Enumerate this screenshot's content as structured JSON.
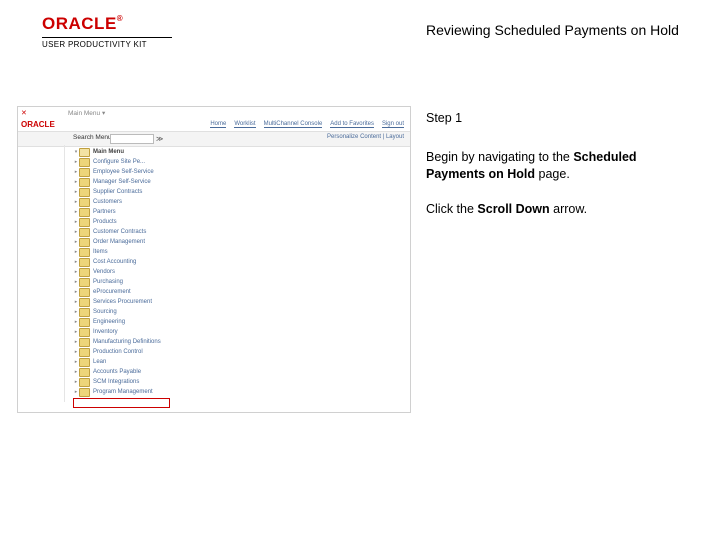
{
  "logo": {
    "brand": "ORACLE",
    "reg": "®",
    "sub": "USER PRODUCTIVITY KIT"
  },
  "title": "Reviewing Scheduled Payments on Hold",
  "instructions": {
    "step": "Step 1",
    "para1_a": "Begin by navigating to the ",
    "para1_b": "Scheduled Payments on Hold",
    "para1_c": " page.",
    "para2_a": "Click the ",
    "para2_b": "Scroll Down",
    "para2_c": " arrow."
  },
  "app": {
    "top_tabs": "Main Menu ▾",
    "tiny_brand": "ORACLE",
    "nav": [
      "Home",
      "Worklist",
      "MultiChannel Console",
      "Add to Favorites",
      "Sign out"
    ],
    "search_label": "Search Menu:",
    "go": "≫",
    "pcenter": "Personalize Content | Layout",
    "menu_top": "Main Menu",
    "menu_items": [
      "Configure Site Pe...",
      "Employee Self-Service",
      "Manager Self-Service",
      "Supplier Contracts",
      "Customers",
      "Partners",
      "Products",
      "Customer Contracts",
      "Order Management",
      "Items",
      "Cost Accounting",
      "Vendors",
      "Purchasing",
      "eProcurement",
      "Services Procurement",
      "Sourcing",
      "Engineering",
      "Inventory",
      "Manufacturing Definitions",
      "Production Control",
      "Lean",
      "Accounts Payable",
      "SCM Integrations",
      "Program Management"
    ]
  }
}
